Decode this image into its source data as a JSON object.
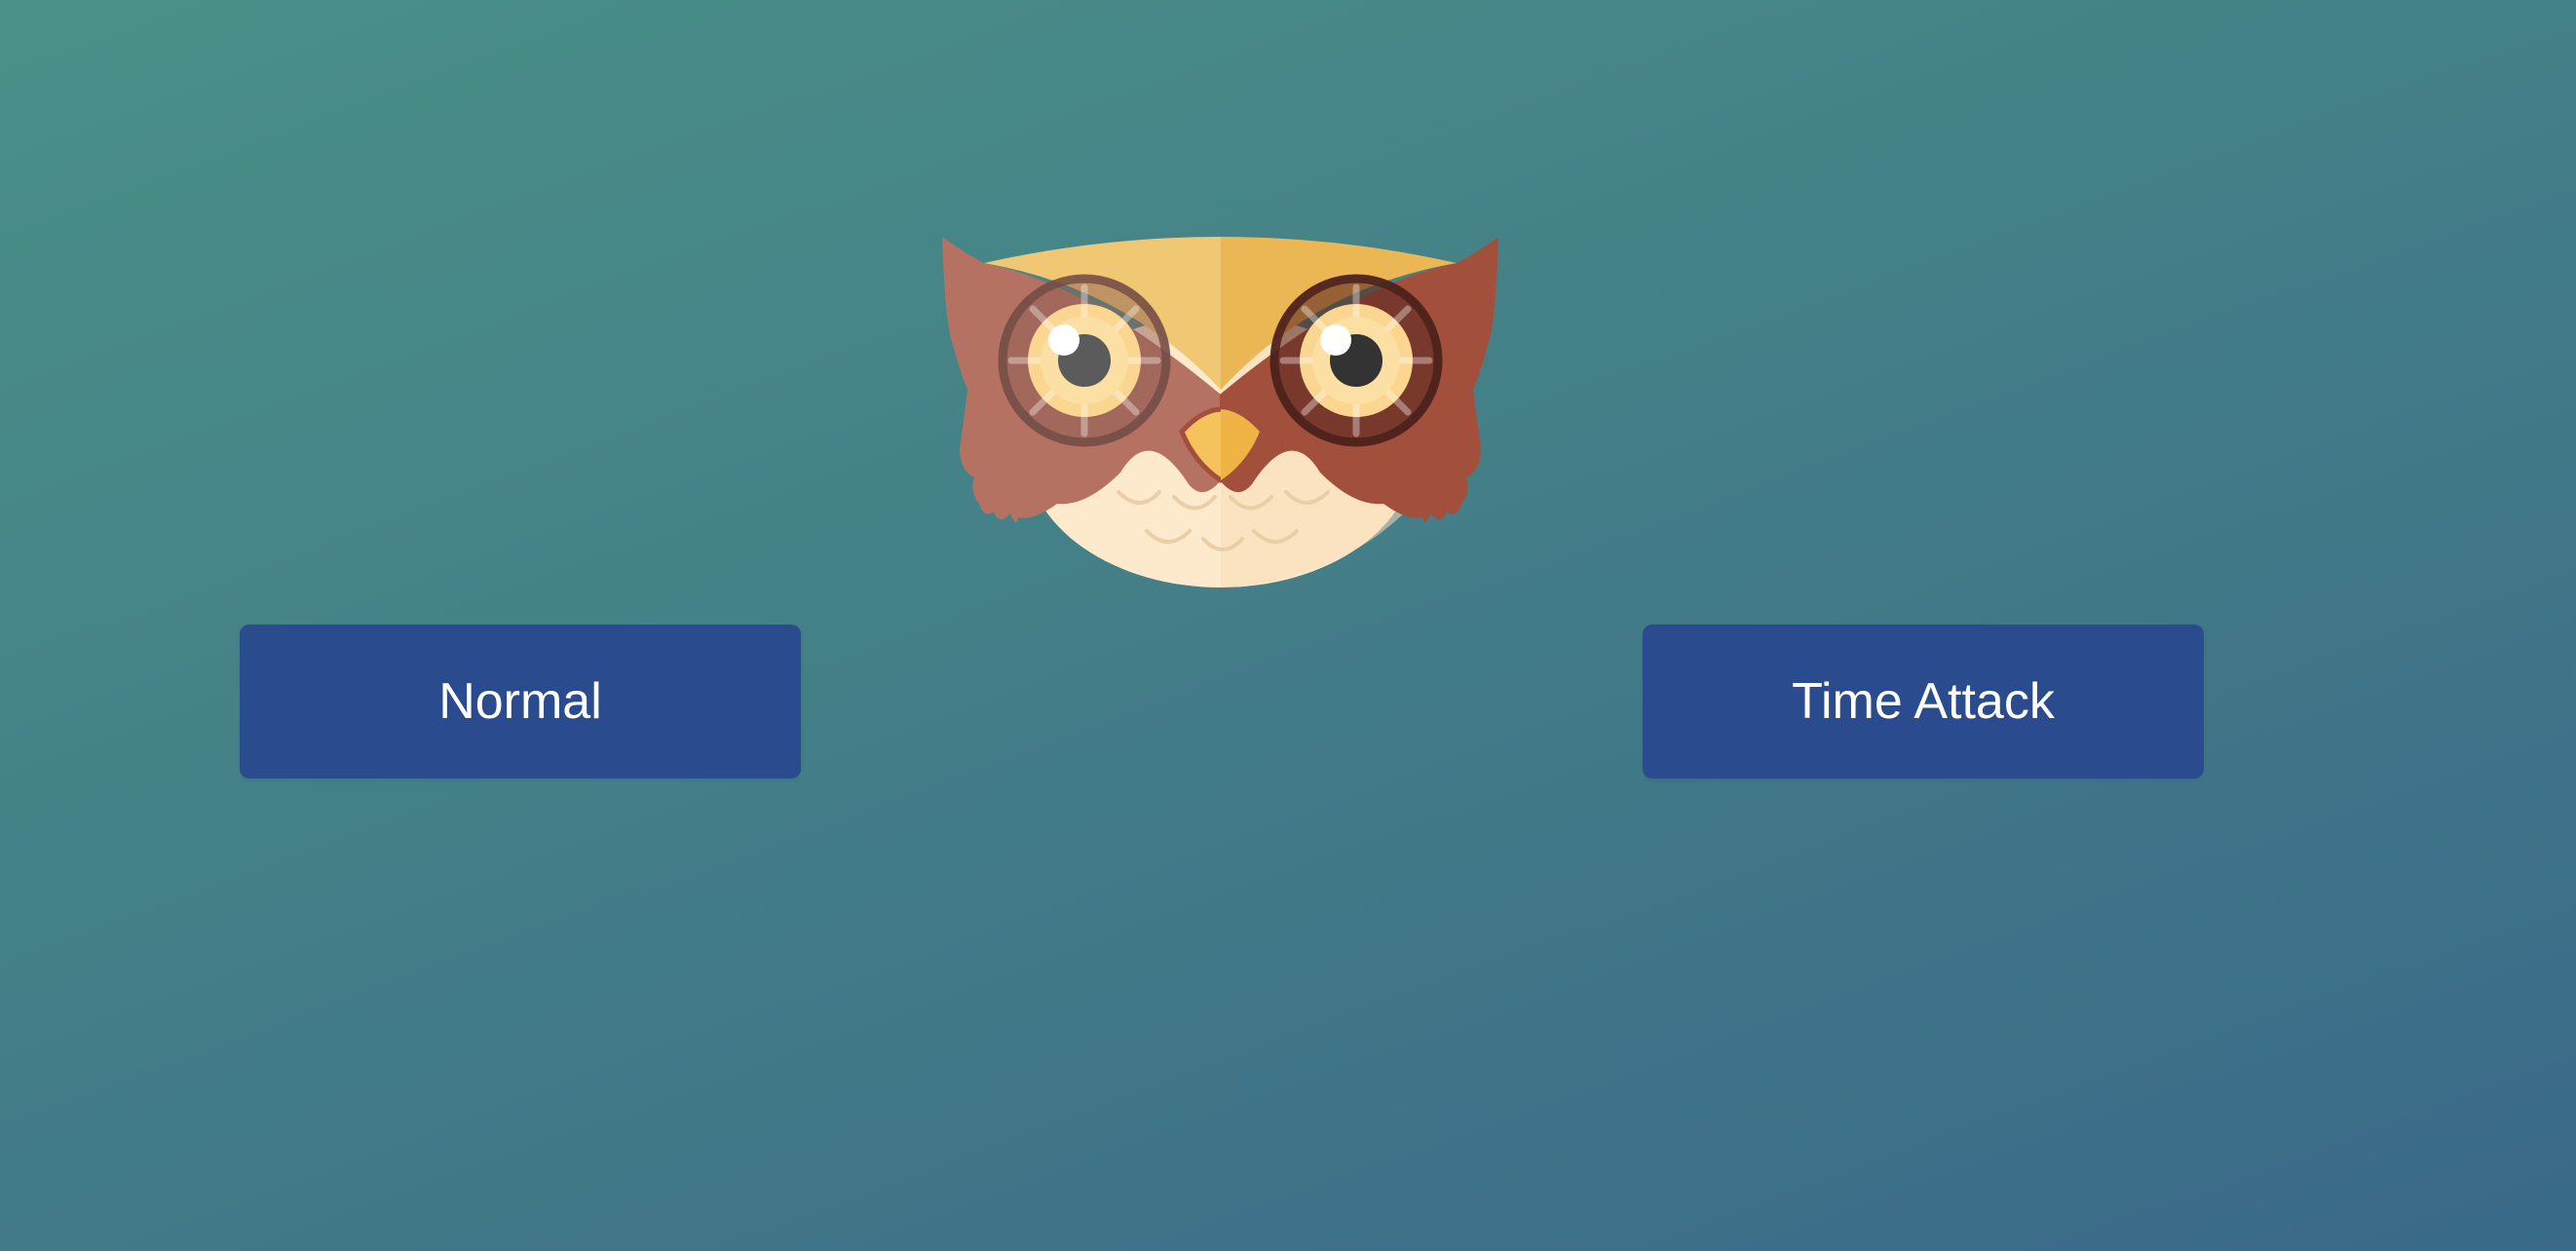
{
  "mascot": {
    "icon": "owl-icon",
    "colors": {
      "feather_left": "#b57162",
      "feather_right": "#a24f3c",
      "brow_left": "#f0c773",
      "brow_right": "#ebb754",
      "belly": "#fde9cb",
      "eye_iris": "#fad690",
      "pupil_left": "#5b5b5b",
      "pupil_right": "#333333"
    }
  },
  "buttons": {
    "normal_label": "Normal",
    "time_attack_label": "Time Attack"
  },
  "colors": {
    "background_start": "#4a9088",
    "background_end": "#3a6989",
    "button_bg": "#2a4b8d",
    "button_text": "#ffffff"
  }
}
